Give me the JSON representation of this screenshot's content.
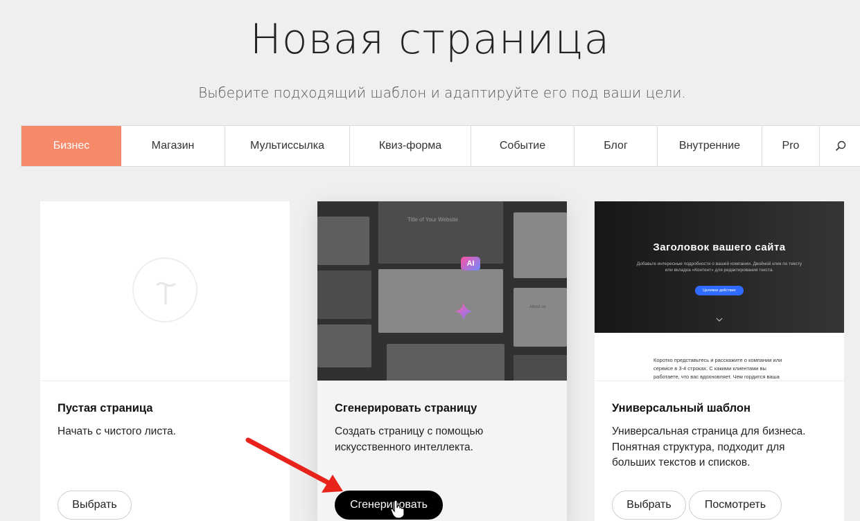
{
  "header": {
    "title": "Новая страница",
    "subtitle": "Выберите подходящий шаблон и адаптируйте его под ваши цели."
  },
  "tabs": [
    {
      "label": "Бизнес",
      "active": true
    },
    {
      "label": "Магазин",
      "active": false
    },
    {
      "label": "Мультиссылка",
      "active": false
    },
    {
      "label": "Квиз-форма",
      "active": false
    },
    {
      "label": "Событие",
      "active": false
    },
    {
      "label": "Блог",
      "active": false
    },
    {
      "label": "Внутренние",
      "active": false
    },
    {
      "label": "Pro",
      "active": false
    }
  ],
  "search_icon": "search-icon",
  "colors": {
    "accent": "#f6896a",
    "dark_button": "#000000",
    "arrow": "#e8231b"
  },
  "cards": [
    {
      "title": "Пустая страница",
      "description": "Начать с чистого листа.",
      "buttons": [
        "Выбрать"
      ]
    },
    {
      "title": "Сгенерировать страницу",
      "description": "Создать страницу с помощью искусственного интеллекта.",
      "buttons": [
        "Сгенерировать"
      ],
      "preview": {
        "badge": "AI",
        "site_title": "Title of Your Website",
        "about": "About us"
      }
    },
    {
      "title": "Универсальный шаблон",
      "description": "Универсальная страница для бизнеса. Понятная структура, подходит для больших текстов и списков.",
      "buttons": [
        "Выбрать",
        "Посмотреть"
      ],
      "preview": {
        "hero_title": "Заголовок вашего сайта",
        "hero_sub": "Добавьте интересные подробности о вашей компании. Двойной клик по тексту или вкладка «Контент» для редактирования текста.",
        "hero_button": "Целевое действие",
        "body_text": "Коротко представьтесь и расскажите о компании или сервисе в 3-4 строках. С какими клиентами вы работаете, что вас вдохновляет. Чем гордится ваша команда, какие у нее ценности и мотивация."
      }
    }
  ]
}
